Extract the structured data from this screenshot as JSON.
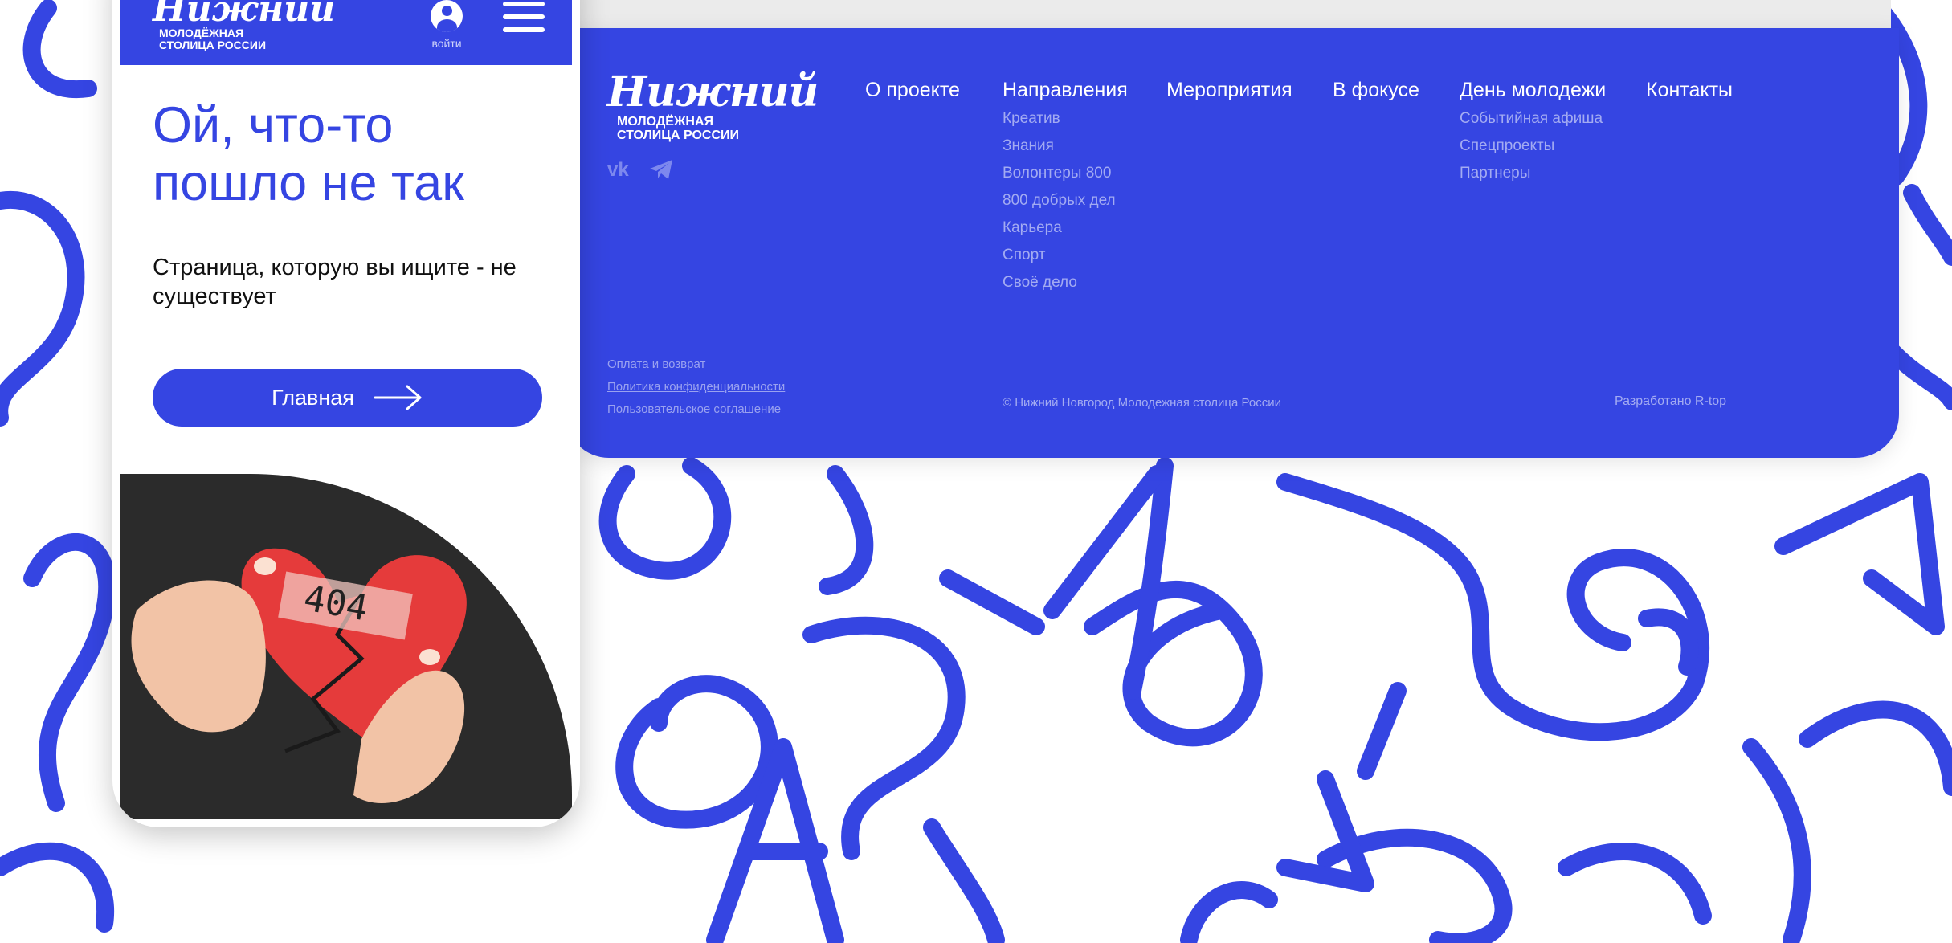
{
  "brand": {
    "script": "Нижний",
    "line1": "Молодёжная",
    "line2": "столица России"
  },
  "phone": {
    "login_label": "войти",
    "title": "Ой, что-то пошло не так",
    "text": "Страница, которую вы ищите - не существует",
    "button_label": "Главная",
    "image_text": "404"
  },
  "footer": {
    "nav": [
      {
        "label": "О проекте",
        "items": []
      },
      {
        "label": "Направления",
        "items": [
          "Креатив",
          "Знания",
          "Волонтеры 800",
          "800 добрых дел",
          "Карьера",
          "Спорт",
          "Своё дело"
        ]
      },
      {
        "label": "Мероприятия",
        "items": []
      },
      {
        "label": "В фокусе",
        "items": []
      },
      {
        "label": "День молодежи",
        "items": [
          "Событийная афиша",
          "Спецпроекты",
          "Партнеры"
        ]
      },
      {
        "label": "Контакты",
        "items": []
      }
    ],
    "legal": [
      "Оплата и возврат",
      "Политика конфиденциальности",
      "Пользовательское соглашение"
    ],
    "copyright": "© Нижний Новгород Молодежная столица России",
    "developer": "Разработано R-top",
    "social_icons": [
      "vk-icon",
      "telegram-icon"
    ]
  },
  "colors": {
    "brand_blue": "#3545e2",
    "muted_link": "#a3abf2"
  }
}
